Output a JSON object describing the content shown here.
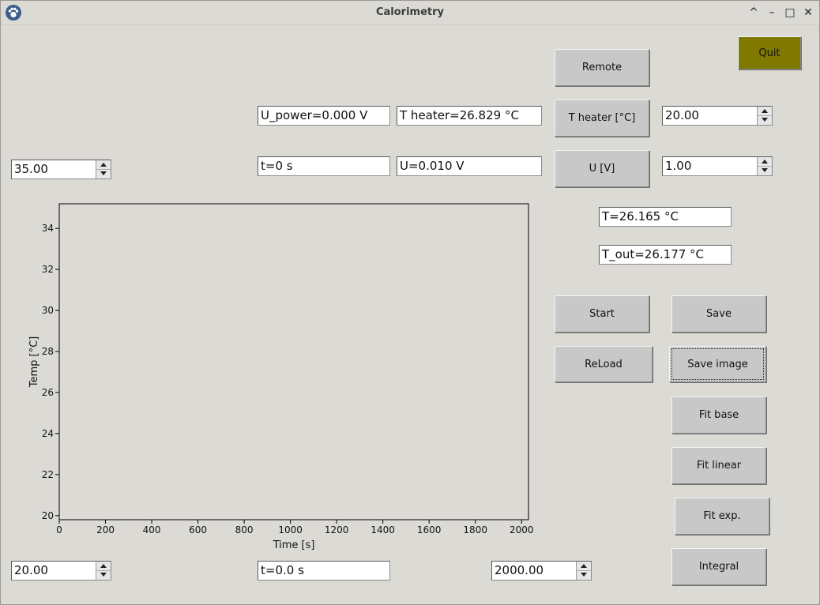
{
  "window": {
    "title": "Calorimetry",
    "controls": [
      "^",
      "–",
      "□",
      "✕"
    ]
  },
  "buttons": {
    "quit": "Quit",
    "remote": "Remote",
    "t_heater": "T heater [°C]",
    "u_v": "U [V]",
    "start": "Start",
    "save": "Save",
    "reload": "ReLoad",
    "save_image": "Save image",
    "fit_base": "Fit base",
    "fit_linear": "Fit linear",
    "fit_exp": "Fit exp.",
    "integral": "Integral"
  },
  "readouts": {
    "u_power": "U_power=0.000 V",
    "t_heater": "T heater=26.829 °C",
    "time": "t=0 s",
    "voltage": "U=0.010 V",
    "temp": "T=26.165 °C",
    "temp_out": "T_out=26.177 °C",
    "time_cursor": "t=0.0 s"
  },
  "spinboxes": {
    "t_heater_set": "20.00",
    "u_set": "1.00",
    "y_max": "35.00",
    "y_min": "20.00",
    "x_max": "2000.00"
  },
  "colors": {
    "quit_button": "#7f7900",
    "background": "#dcdad5"
  },
  "chart_data": {
    "type": "line",
    "xlabel": "Time [s]",
    "ylabel": "Temp [°C]",
    "xlim": [
      0,
      2030
    ],
    "ylim": [
      19.8,
      35.2
    ],
    "xticks": [
      0,
      200,
      400,
      600,
      800,
      1000,
      1200,
      1400,
      1600,
      1800,
      2000
    ],
    "yticks": [
      20,
      22,
      24,
      26,
      28,
      30,
      32,
      34
    ],
    "series": [],
    "grid": false
  }
}
